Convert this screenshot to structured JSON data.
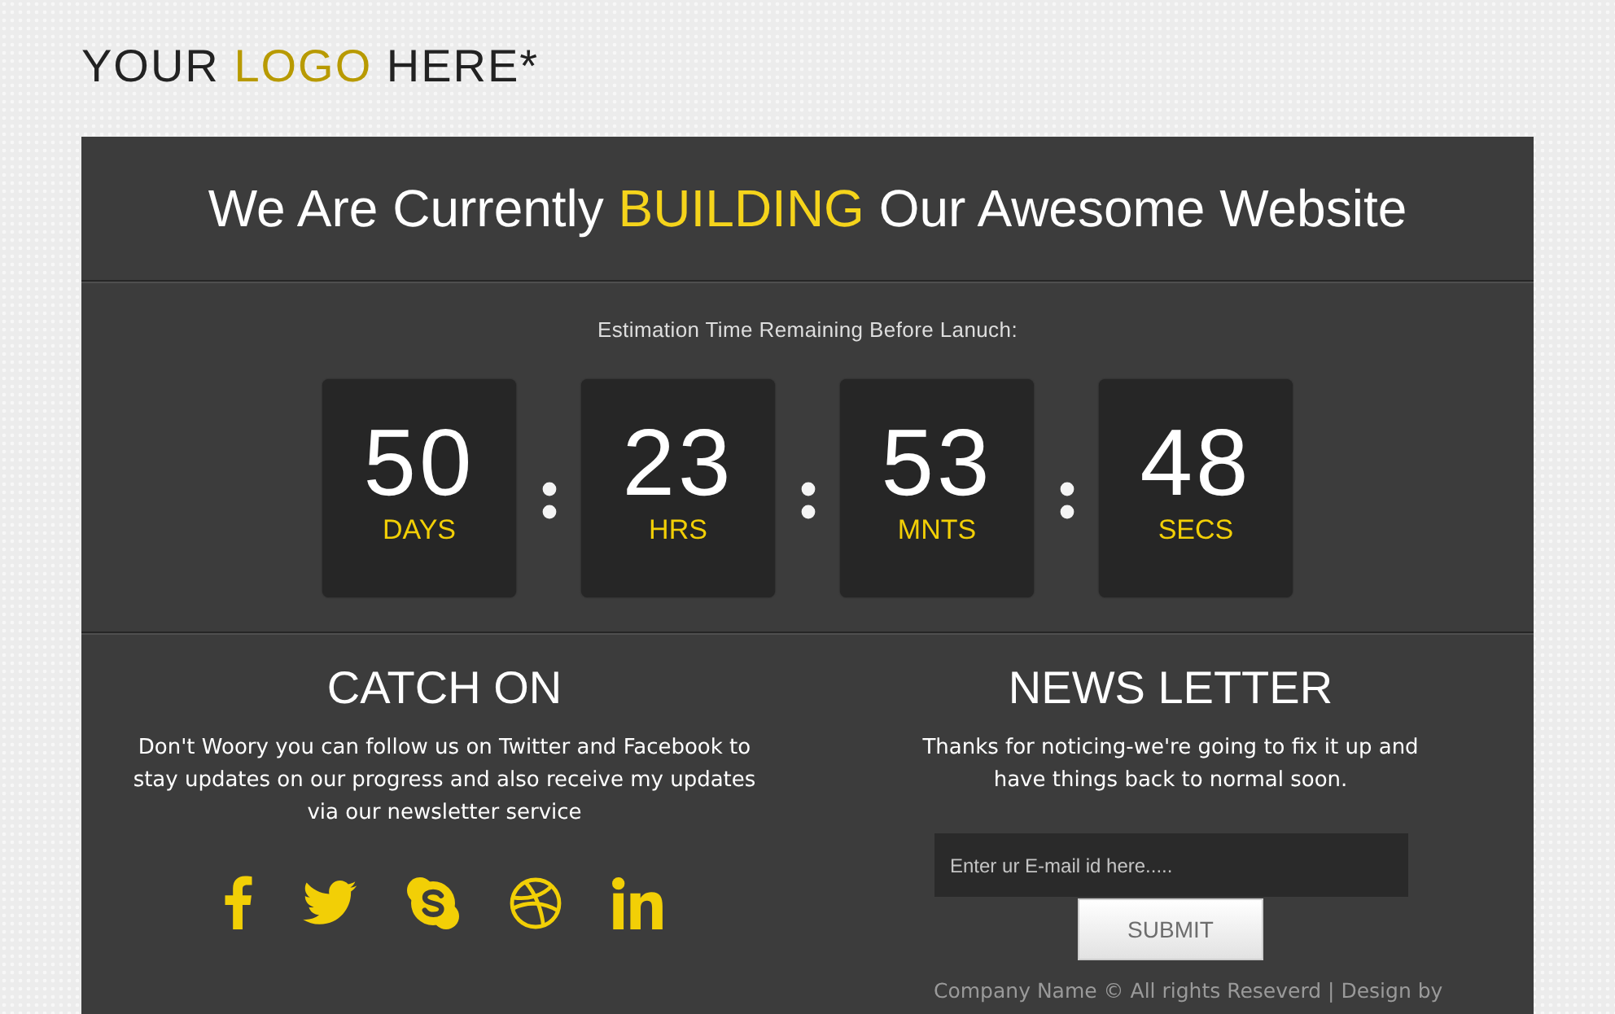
{
  "logo": {
    "parts": [
      {
        "text": "YOUR",
        "highlight": false
      },
      {
        "text": "LOGO",
        "highlight": true
      },
      {
        "text": "HERE*",
        "highlight": false
      }
    ]
  },
  "headline": {
    "parts": [
      {
        "text": "We Are Currently",
        "highlight": false
      },
      {
        "text": "BUILDING",
        "highlight": true
      },
      {
        "text": "Our Awesome Website",
        "highlight": false
      }
    ]
  },
  "countdown": {
    "label": "Estimation Time Remaining Before Lanuch:",
    "units": [
      {
        "value": "50",
        "unit": "DAYS"
      },
      {
        "value": "23",
        "unit": "HRS"
      },
      {
        "value": "53",
        "unit": "MNTS"
      },
      {
        "value": "48",
        "unit": "SECS"
      }
    ]
  },
  "catch_on": {
    "title": "CATCH ON",
    "text": "Don't Woory you can follow us on Twitter and Facebook to stay updates on our progress and also receive my updates via our newsletter service"
  },
  "newsletter": {
    "title": "NEWS LETTER",
    "text": "Thanks for noticing-we're going to fix it up and have things back to normal soon.",
    "email_field": {
      "placeholder": "Enter ur E-mail id here....."
    },
    "submit_button": "SUBMIT"
  },
  "footer": {
    "text": "Company Name © All rights Reseverd | Design by"
  }
}
